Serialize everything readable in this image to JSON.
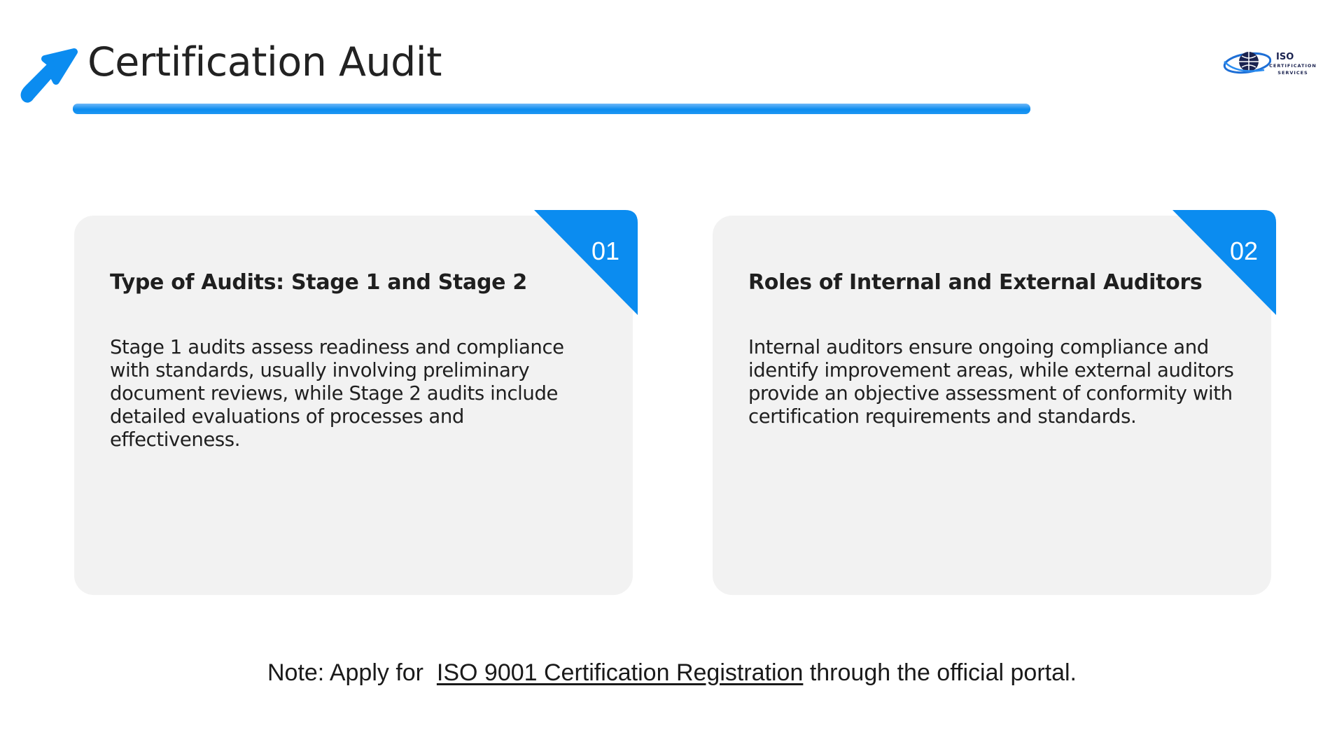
{
  "header": {
    "title": "Certification Audit",
    "arrow_icon": "arrow-up-right-icon",
    "accent_color": "#0b8cf0"
  },
  "logo": {
    "icon": "globe-logo-icon",
    "line1": "ISO",
    "line2": "CERTIFICATION",
    "line3": "SERVICES"
  },
  "cards": [
    {
      "number": "01",
      "heading": "Type of Audits: Stage 1 and Stage 2",
      "body": "Stage 1 audits assess readiness and compliance with standards, usually involving preliminary document reviews, while Stage 2 audits include detailed evaluations of processes and effectiveness."
    },
    {
      "number": "02",
      "heading": "Roles of Internal and External Auditors",
      "body": "Internal auditors ensure ongoing compliance and identify improvement areas, while external auditors provide an objective assessment of conformity with certification requirements and standards."
    }
  ],
  "note": {
    "prefix": "Note: Apply for  ",
    "link_text": "ISO 9001 Certification Registration",
    "suffix": " through the official portal."
  }
}
